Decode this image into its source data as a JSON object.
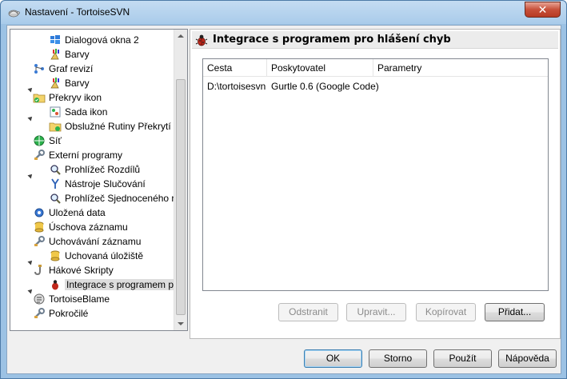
{
  "window": {
    "title": "Nastavení - TortoiseSVN",
    "close_label": "✕"
  },
  "tree": {
    "items": [
      {
        "label": "Dialogová okna 2",
        "icon": "windows-icon",
        "level": 2,
        "selected": false
      },
      {
        "label": "Barvy",
        "icon": "brush-colors-icon",
        "level": 2,
        "selected": false
      },
      {
        "label": "Graf revizí",
        "icon": "revision-graph-icon",
        "level": 1,
        "selected": false
      },
      {
        "label": "Barvy",
        "icon": "brush-colors-icon",
        "level": 2,
        "selected": false
      },
      {
        "label": "Překryv ikon",
        "icon": "overlay-folder-icon",
        "level": 1,
        "selected": false
      },
      {
        "label": "Sada ikon",
        "icon": "icon-set-icon",
        "level": 2,
        "selected": false
      },
      {
        "label": "Obslužné Rutiny Překrytí",
        "icon": "overlay-handlers-icon",
        "level": 2,
        "selected": false
      },
      {
        "label": "Síť",
        "icon": "network-icon",
        "level": 1,
        "selected": false
      },
      {
        "label": "Externí programy",
        "icon": "wrench-icon",
        "level": 1,
        "selected": false
      },
      {
        "label": "Prohlížeč Rozdílů",
        "icon": "magnifier-icon",
        "level": 2,
        "selected": false
      },
      {
        "label": "Nástroje Slučování",
        "icon": "merge-icon",
        "level": 2,
        "selected": false
      },
      {
        "label": "Prohlížeč Sjednoceného r",
        "icon": "magnifier-icon",
        "level": 2,
        "selected": false
      },
      {
        "label": "Uložená data",
        "icon": "gear-icon",
        "level": 1,
        "selected": false
      },
      {
        "label": "Úschova záznamu",
        "icon": "database-icon",
        "level": 1,
        "selected": false
      },
      {
        "label": "Uchovávání záznamu",
        "icon": "wrench-icon",
        "level": 1,
        "selected": false
      },
      {
        "label": "Uchovaná úložiště",
        "icon": "database-icon",
        "level": 2,
        "selected": false
      },
      {
        "label": "Hákové Skripty",
        "icon": "hook-icon",
        "level": 1,
        "selected": false
      },
      {
        "label": "Integrace s programem p",
        "icon": "bug-icon",
        "level": 2,
        "selected": true
      },
      {
        "label": "TortoiseBlame",
        "icon": "blame-icon",
        "level": 1,
        "selected": false
      },
      {
        "label": "Pokročilé",
        "icon": "wrench-icon",
        "level": 1,
        "selected": false
      }
    ]
  },
  "panel": {
    "title": "Integrace s programem pro hlášení chyb",
    "columns": [
      "Cesta",
      "Poskytovatel",
      "Parametry"
    ],
    "rows": [
      [
        "D:\\tortoisesvn",
        "Gurtle 0.6 (Google Code)",
        ""
      ]
    ],
    "buttons": {
      "remove": "Odstranit",
      "edit": "Upravit...",
      "copy": "Kopírovat",
      "add": "Přidat..."
    }
  },
  "footer": {
    "ok": "OK",
    "cancel": "Storno",
    "apply": "Použít",
    "help": "Nápověda"
  }
}
